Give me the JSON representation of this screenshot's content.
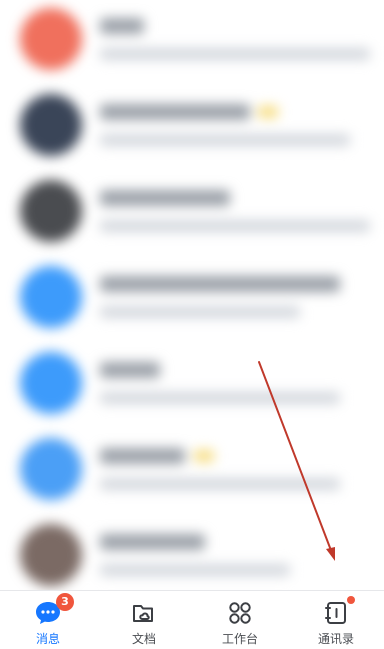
{
  "chat_list": {
    "rows": [
      {
        "avatar_color": "#f0705d",
        "tag": false
      },
      {
        "avatar_color": "#3a4558",
        "tag": true
      },
      {
        "avatar_color": "#4a4c50",
        "tag": false
      },
      {
        "avatar_color": "#3d9bfb",
        "tag": false
      },
      {
        "avatar_color": "#3d9bfb",
        "tag": false
      },
      {
        "avatar_color": "#4b9ff6",
        "tag": true
      },
      {
        "avatar_color": "#7b6a64",
        "tag": false
      }
    ]
  },
  "tabbar": {
    "tabs": [
      {
        "label": "消息",
        "icon": "chat-bubble-icon",
        "active": true,
        "badge": "3"
      },
      {
        "label": "文档",
        "icon": "folder-cloud-icon",
        "active": false
      },
      {
        "label": "工作台",
        "icon": "workbench-grid-icon",
        "active": false
      },
      {
        "label": "通讯录",
        "icon": "contacts-book-icon",
        "active": false,
        "dot": true
      }
    ]
  },
  "colors": {
    "accent": "#1677ff",
    "badge": "#f0563d",
    "annotation_arrow": "#c0392b"
  }
}
